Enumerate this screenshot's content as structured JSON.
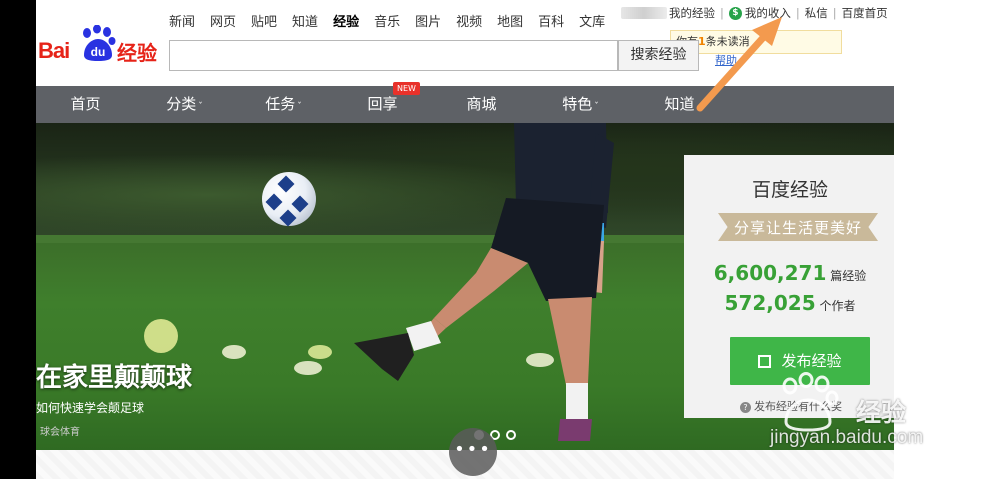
{
  "topnav": {
    "links": [
      "新闻",
      "网页",
      "贴吧",
      "知道",
      "经验",
      "音乐",
      "图片",
      "视频",
      "地图",
      "百科",
      "文库"
    ],
    "active": "经验"
  },
  "userbar": {
    "my_jingyan": "我的经验",
    "my_income": "我的收入",
    "private_msg": "私信",
    "baidu_home": "百度首页",
    "money_symbol": "$"
  },
  "message_tip": {
    "prefix": "你有",
    "count": "1",
    "suffix": "条未读消"
  },
  "logo": {
    "bai": "Bai",
    "du": "du",
    "jingyan": "经验"
  },
  "search": {
    "value": "",
    "button": "搜索经验",
    "extra_link": "帮助"
  },
  "mainnav": {
    "items": [
      {
        "label": "首页",
        "caret": false
      },
      {
        "label": "分类",
        "caret": true
      },
      {
        "label": "任务",
        "caret": true
      },
      {
        "label": "回享",
        "caret": false
      },
      {
        "label": "商城",
        "caret": false
      },
      {
        "label": "特色",
        "caret": true
      },
      {
        "label": "知道",
        "caret": false
      }
    ],
    "new_badge": "NEW",
    "caret_glyph": "ˇ"
  },
  "banner": {
    "headline": "在家里颠颠球",
    "subline": "如何快速学会颠足球",
    "source": "球会体育",
    "carousel_active": 0
  },
  "card": {
    "title": "百度经验",
    "slogan": "分享让生活更美好",
    "articles_count": "6,600,271",
    "articles_unit": "篇经验",
    "authors_count": "572,025",
    "authors_unit": "个作者",
    "publish_button": "发布经验",
    "help_text": "发布经验有什么奖",
    "help_icon": "?"
  },
  "more_button": "•••",
  "watermark": {
    "jingyan": "经验",
    "domain": "jingyan.baidu.com"
  },
  "colors": {
    "brand_red": "#e62318",
    "brand_blue": "#2932e1",
    "green": "#3fb648",
    "nav_bg": "#5e6166",
    "arrow": "#f39a4e"
  }
}
